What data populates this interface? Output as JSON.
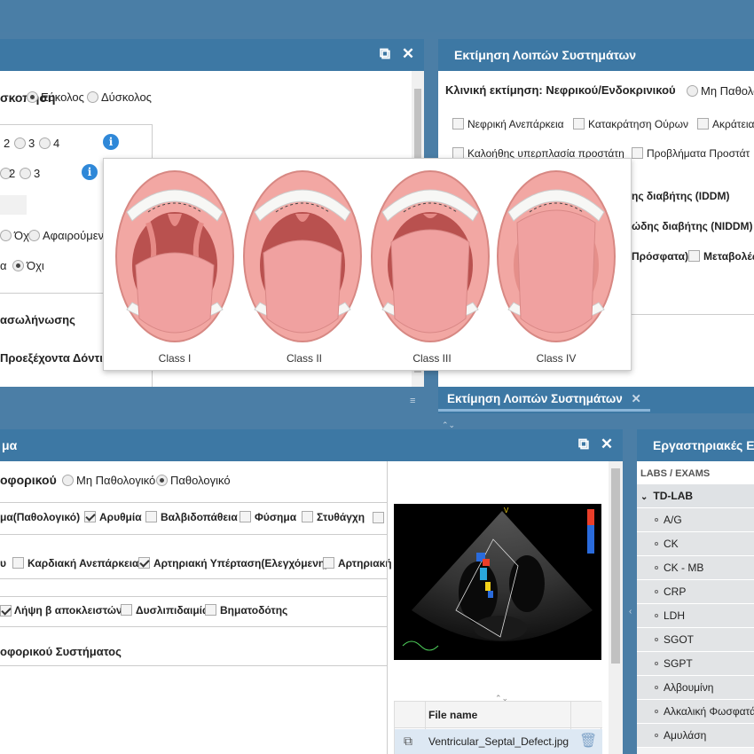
{
  "panel_top_left": {
    "ventilation_label": "σκοπηση",
    "radio_easy": "Εύκολος",
    "radio_hard": "Δύσκολος",
    "row1": [
      "2",
      "3",
      "4"
    ],
    "row2": [
      "2",
      "3"
    ],
    "radio_no1": "Όχι",
    "radio_removable": "Αφαιρούμεν",
    "row_a": "α",
    "radio_no2": "Όχι",
    "label_intubation": "ασωλήνωσης",
    "label_teeth": "Προεξέχοντα Δόντια"
  },
  "panel_top_right": {
    "title": "Εκτίμηση Λοιπών Συστημάτων",
    "clinical_label": "Κλινική εκτίμηση: Νεφρικού/Ενδοκρινικού",
    "radio_nonpath": "Μη Παθολο",
    "checks": [
      "Νεφρική Ανεπάρκεια",
      "Κατακράτηση Ούρων",
      "Ακράτεια",
      "Καλοήθης υπερπλασία προστάτη",
      "Προβλήματα Προστάτ"
    ],
    "diabetes_iddm": "ης διαβήτης (IDDM)",
    "diabetes_niddm": "ώδης διαβήτης (NIDDM)",
    "recent": "Πρόσφατα)",
    "metabolic": "Μεταβολές"
  },
  "popup": {
    "labels": [
      "Class I",
      "Class II",
      "Class III",
      "Class IV"
    ]
  },
  "tabbar": {
    "tab_label": "Εκτίμηση Λοιπών Συστημάτων"
  },
  "panel_bottom_left": {
    "title": "μα",
    "clinical_label": "οφορικού",
    "radio_nonpath": "Μη Παθολογικό",
    "radio_path": "Παθολογικό",
    "row1_label": "μα(Παθολογικό)",
    "row1_checks": [
      "Αρυθμία",
      "Βαλβιδοπάθεια",
      "Φύσημα",
      "Στυθάγχη"
    ],
    "row2_label": "υ",
    "row2_checks": [
      "Καρδιακή Ανεπάρκεια",
      "Αρτηριακή Υπέρταση(Ελεγχόμενη)",
      "Αρτηριακή"
    ],
    "row3_checks": [
      "Λήψη β αποκλειστών",
      "Δυσλιπιδαιμία",
      "Βηματοδότης"
    ],
    "section_label": "οφορικού Συστήματος",
    "file_header": "File name",
    "file_name": "Ventricular_Septal_Defect.jpg"
  },
  "panel_labs": {
    "title": "Εργαστηριακές Ε",
    "subheader": "LABS / EXAMS",
    "group": "TD-LAB",
    "items": [
      "A/G",
      "CK",
      "CK - MB",
      "CRP",
      "LDH",
      "SGOT",
      "SGPT",
      "Αλβουμίνη",
      "Αλκαλική Φωσφατά",
      "Αμυλάση"
    ]
  },
  "colors": {
    "header": "#3d78a4",
    "background": "#4b7ea6",
    "info": "#2f88d8"
  }
}
